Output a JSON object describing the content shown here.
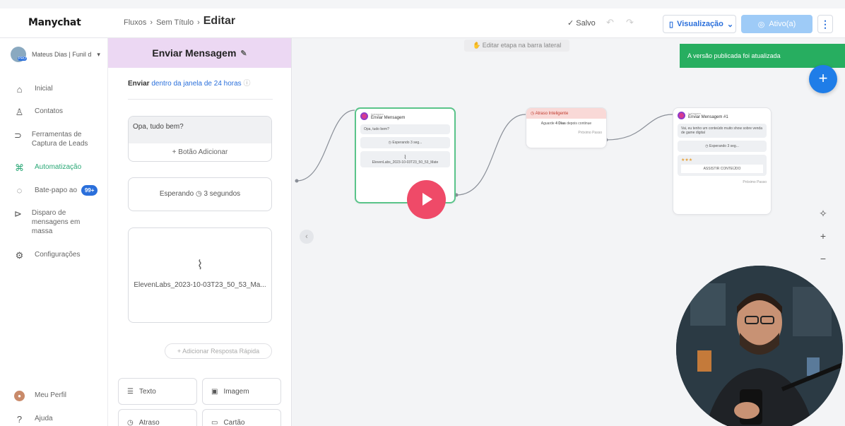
{
  "topbar": {
    "logo": "Manychat",
    "crumb1": "Fluxos",
    "crumb2": "Sem Título",
    "current": "Editar",
    "saved": "✓ Salvo",
    "preview": "Visualização",
    "active": "Ativo(a)"
  },
  "sidebar": {
    "account": "Mateus Dias | Funil d",
    "items": [
      {
        "label": "Inicial"
      },
      {
        "label": "Contatos"
      },
      {
        "label": "Ferramentas de Captura de Leads"
      },
      {
        "label": "Automatização"
      },
      {
        "label": "Bate-papo ao",
        "badge": "99+"
      },
      {
        "label": "Disparo de mensagens em massa"
      },
      {
        "label": "Configurações"
      }
    ],
    "profile": "Meu Perfil",
    "help": "Ajuda"
  },
  "panel": {
    "title": "Enviar Mensagem",
    "send_prefix": "Enviar",
    "send_link": "dentro da janela de 24 horas",
    "message": "Opa, tudo bem?",
    "add_button": "+ Botão Adicionar",
    "waiting": "Esperando ◷ 3 segundos",
    "file": "ElevenLabs_2023-10-03T23_50_53_Ma...",
    "quick_reply": "+ Adicionar Resposta Rápida",
    "tools": [
      "Texto",
      "Imagem",
      "Atraso",
      "Cartão"
    ]
  },
  "canvas": {
    "hint": "Editar etapa na barra lateral",
    "toast": "A versão publicada foi atualizada",
    "node1": {
      "channel": "Instagram",
      "title": "Enviar Mensagem",
      "msg": "Opa, tudo bem?",
      "wait": "◷ Esperando 3 seg...",
      "file": "ElevenLabs_2023-10-03T23_50_53_Mate"
    },
    "node2": {
      "title": "Atraso Inteligente",
      "body_prefix": "Aguarde",
      "body_bold": "4 Dias",
      "body_suffix": "depois continue",
      "next": "Próximo Passo"
    },
    "node3": {
      "channel": "Instagram",
      "title": "Enviar Mensagem #1",
      "msg": "Vai, eu tenho um conteúdo muito show sobre venda de game digital",
      "wait": "◷ Esperando 3 seg...",
      "stars": "★★★",
      "cta": "ASSISTIR CONTEÚDO",
      "next": "Próximo Passo"
    }
  },
  "colors": {
    "accent": "#2a6fdb",
    "panel_head": "#ecd8f3",
    "toast": "#27ae60",
    "play": "#ef4a68",
    "active_nav": "#2aa876"
  }
}
